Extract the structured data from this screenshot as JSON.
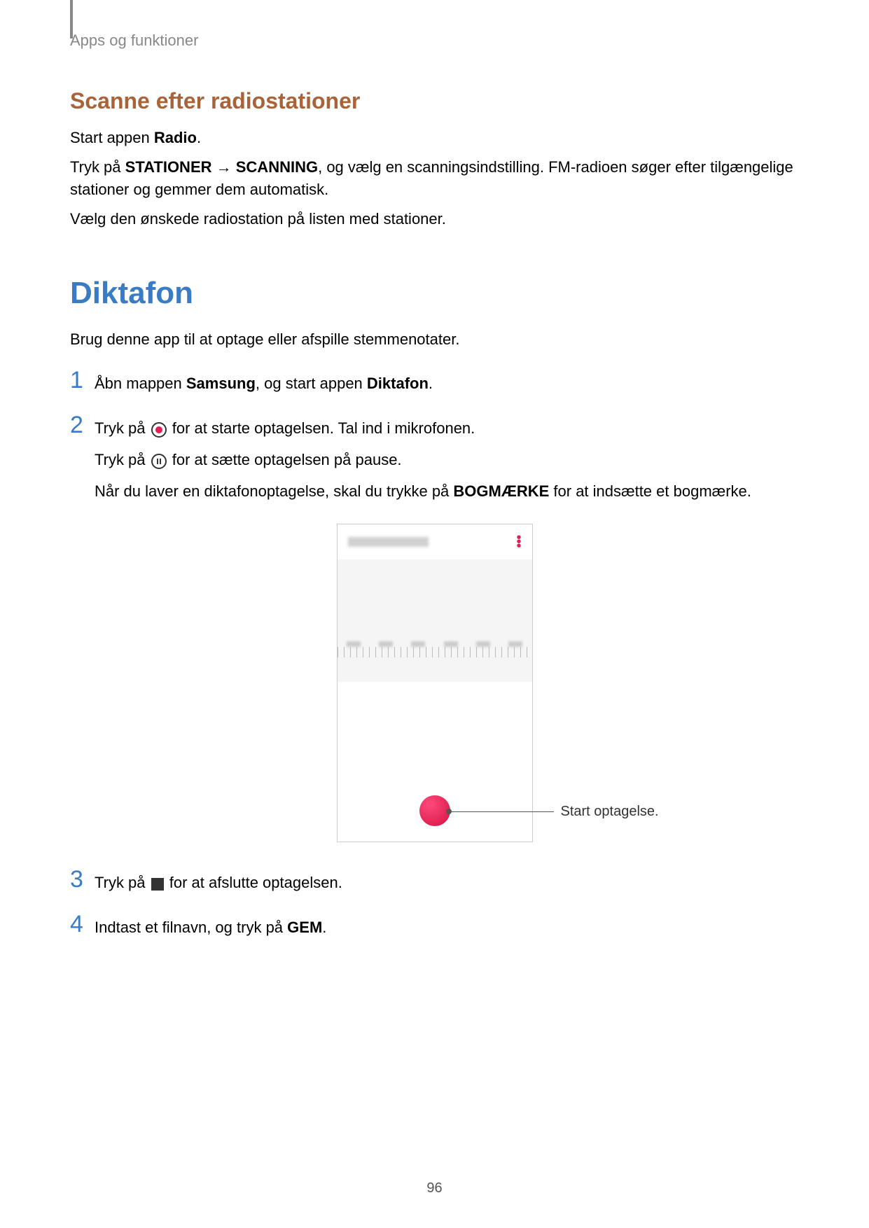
{
  "breadcrumb": "Apps og funktioner",
  "section1": {
    "heading": "Scanne efter radiostationer",
    "p1_a": "Start appen ",
    "p1_b": "Radio",
    "p1_c": ".",
    "p2_a": "Tryk på ",
    "p2_b": "STATIONER",
    "p2_arrow": " → ",
    "p2_c": "SCANNING",
    "p2_d": ", og vælg en scanningsindstilling. FM-radioen søger efter tilgængelige stationer og gemmer dem automatisk.",
    "p3": "Vælg den ønskede radiostation på listen med stationer."
  },
  "section2": {
    "heading": "Diktafon",
    "intro": "Brug denne app til at optage eller afspille stemmenotater.",
    "step1": {
      "num": "1",
      "a": "Åbn mappen ",
      "b": "Samsung",
      "c": ", og start appen ",
      "d": "Diktafon",
      "e": "."
    },
    "step2": {
      "num": "2",
      "line1_a": "Tryk på ",
      "line1_b": " for at starte optagelsen. Tal ind i mikrofonen.",
      "line2_a": "Tryk på ",
      "line2_b": " for at sætte optagelsen på pause.",
      "line3_a": "Når du laver en diktafonoptagelse, skal du trykke på ",
      "line3_b": "BOGMÆRKE",
      "line3_c": " for at indsætte et bogmærke."
    },
    "callout": "Start optagelse.",
    "step3": {
      "num": "3",
      "a": "Tryk på ",
      "b": " for at afslutte optagelsen."
    },
    "step4": {
      "num": "4",
      "a": "Indtast et filnavn, og tryk på ",
      "b": "GEM",
      "c": "."
    }
  },
  "page": "96"
}
